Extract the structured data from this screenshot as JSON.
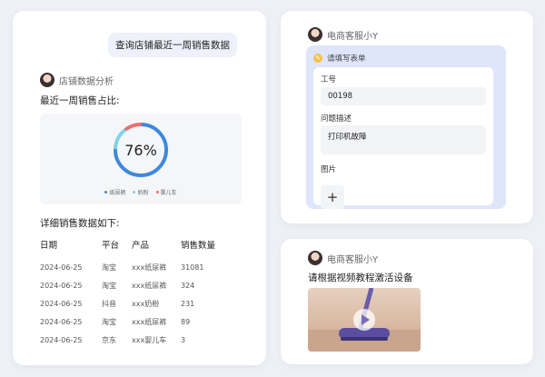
{
  "left": {
    "user_message": "查询店铺最近一周销售数据",
    "agent_name": "店铺数据分析",
    "chart_title": "最近一周销售占比:",
    "detail_title": "详细销售数据如下:",
    "table": {
      "headers": [
        "日期",
        "平台",
        "产品",
        "销售数量"
      ],
      "rows": [
        [
          "2024-06-25",
          "淘宝",
          "xxx纸尿裤",
          "31081"
        ],
        [
          "2024-06-25",
          "淘宝",
          "xxx纸尿裤",
          "324"
        ],
        [
          "2024-06-25",
          "抖音",
          "xxx奶粉",
          "231"
        ],
        [
          "2024-06-25",
          "淘宝",
          "xxx纸尿裤",
          "89"
        ],
        [
          "2024-06-25",
          "京东",
          "xxx婴儿车",
          "3"
        ]
      ]
    }
  },
  "chart_data": {
    "type": "pie",
    "center_label": "76%",
    "labels": [
      "纸尿裤",
      "奶粉",
      "婴儿车"
    ],
    "values": [
      76,
      14,
      10
    ],
    "colors": [
      "#3e88dd",
      "#7fd3e6",
      "#e8716f"
    ]
  },
  "right_top": {
    "agent_name": "电商客服小Y",
    "form_header": "请填写表单",
    "fields": {
      "id_label": "工号",
      "id_value": "00198",
      "desc_label": "问题描述",
      "desc_value": "打印机故障",
      "image_label": "图片",
      "add_symbol": "+"
    }
  },
  "right_bottom": {
    "agent_name": "电商客服小Y",
    "question": "请根据视频教程激活设备"
  }
}
